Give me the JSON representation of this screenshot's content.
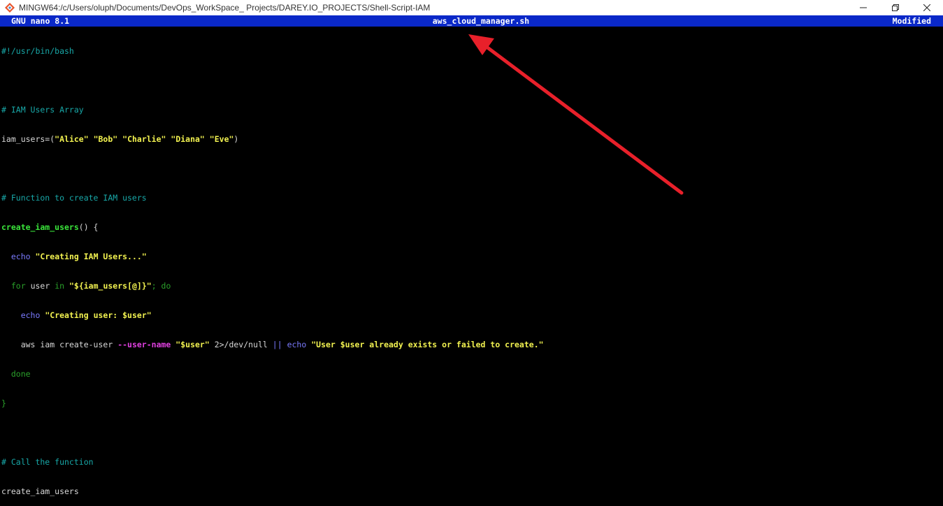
{
  "window": {
    "title": "MINGW64:/c/Users/oluph/Documents/DevOps_WorkSpace_ Projects/DAREY.IO_PROJECTS/Shell-Script-IAM",
    "icons": [
      "mingw-icon",
      "minimize-icon",
      "maximize-icon",
      "close-icon"
    ]
  },
  "nano": {
    "version_label": "GNU nano 8.1",
    "filename": "aws_cloud_manager.sh",
    "status": "Modified"
  },
  "code": {
    "l1": "#!/usr/bin/bash",
    "l3": "# IAM Users Array",
    "l4_var": "iam_users=(",
    "l4_s1": "\"Alice\"",
    "l4_s2": "\"Bob\"",
    "l4_s3": "\"Charlie\"",
    "l4_s4": "\"Diana\"",
    "l4_s5": "\"Eve\"",
    "l4_end": ")",
    "l6": "# Function to create IAM users",
    "l7_func": "create_iam_users",
    "l7_rest": "() {",
    "l8_cmd": "echo",
    "l8_str": "\"Creating IAM Users...\"",
    "l9_for": "for",
    "l9_user": " user ",
    "l9_in": "in",
    "l9_str": "\"${iam_users[@]}\"",
    "l9_semi": "; ",
    "l9_do": "do",
    "l10_cmd": "echo",
    "l10_str": "\"Creating user: $user\"",
    "l11_aws": "aws iam create-user ",
    "l11_opt": "--user-name",
    "l11_str": "\"$user\"",
    "l11_redir": " 2>/dev/null ",
    "l11_or": "||",
    "l11_cmd": "echo",
    "l11_str2": "\"User $user already exists or failed to create.\"",
    "l12_done": "done",
    "l13_close": "}",
    "l15": "# Call the function",
    "l16": "create_iam_users"
  },
  "annotation": {
    "arrow_color": "#e8202a"
  }
}
